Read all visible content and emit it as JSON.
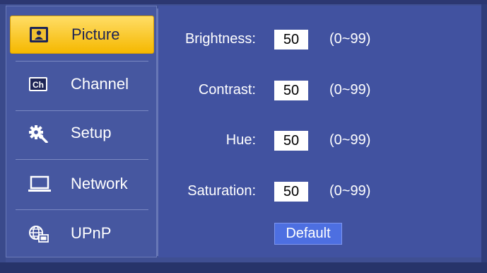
{
  "sidebar": {
    "items": [
      {
        "label": "Picture",
        "icon": "picture-icon"
      },
      {
        "label": "Channel",
        "icon": "channel-icon"
      },
      {
        "label": "Setup",
        "icon": "gear-icon"
      },
      {
        "label": "Network",
        "icon": "laptop-icon"
      },
      {
        "label": "UPnP",
        "icon": "globe-icon"
      }
    ],
    "active_index": 0
  },
  "picture_settings": {
    "rows": [
      {
        "label": "Brightness:",
        "value": "50",
        "range": "(0~99)"
      },
      {
        "label": "Contrast:",
        "value": "50",
        "range": "(0~99)"
      },
      {
        "label": "Hue:",
        "value": "50",
        "range": "(0~99)"
      },
      {
        "label": "Saturation:",
        "value": "50",
        "range": "(0~99)"
      }
    ],
    "default_button": "Default"
  },
  "colors": {
    "background": "#3f4f92",
    "active_tab": "#f5b800",
    "button": "#4d6fe1"
  }
}
